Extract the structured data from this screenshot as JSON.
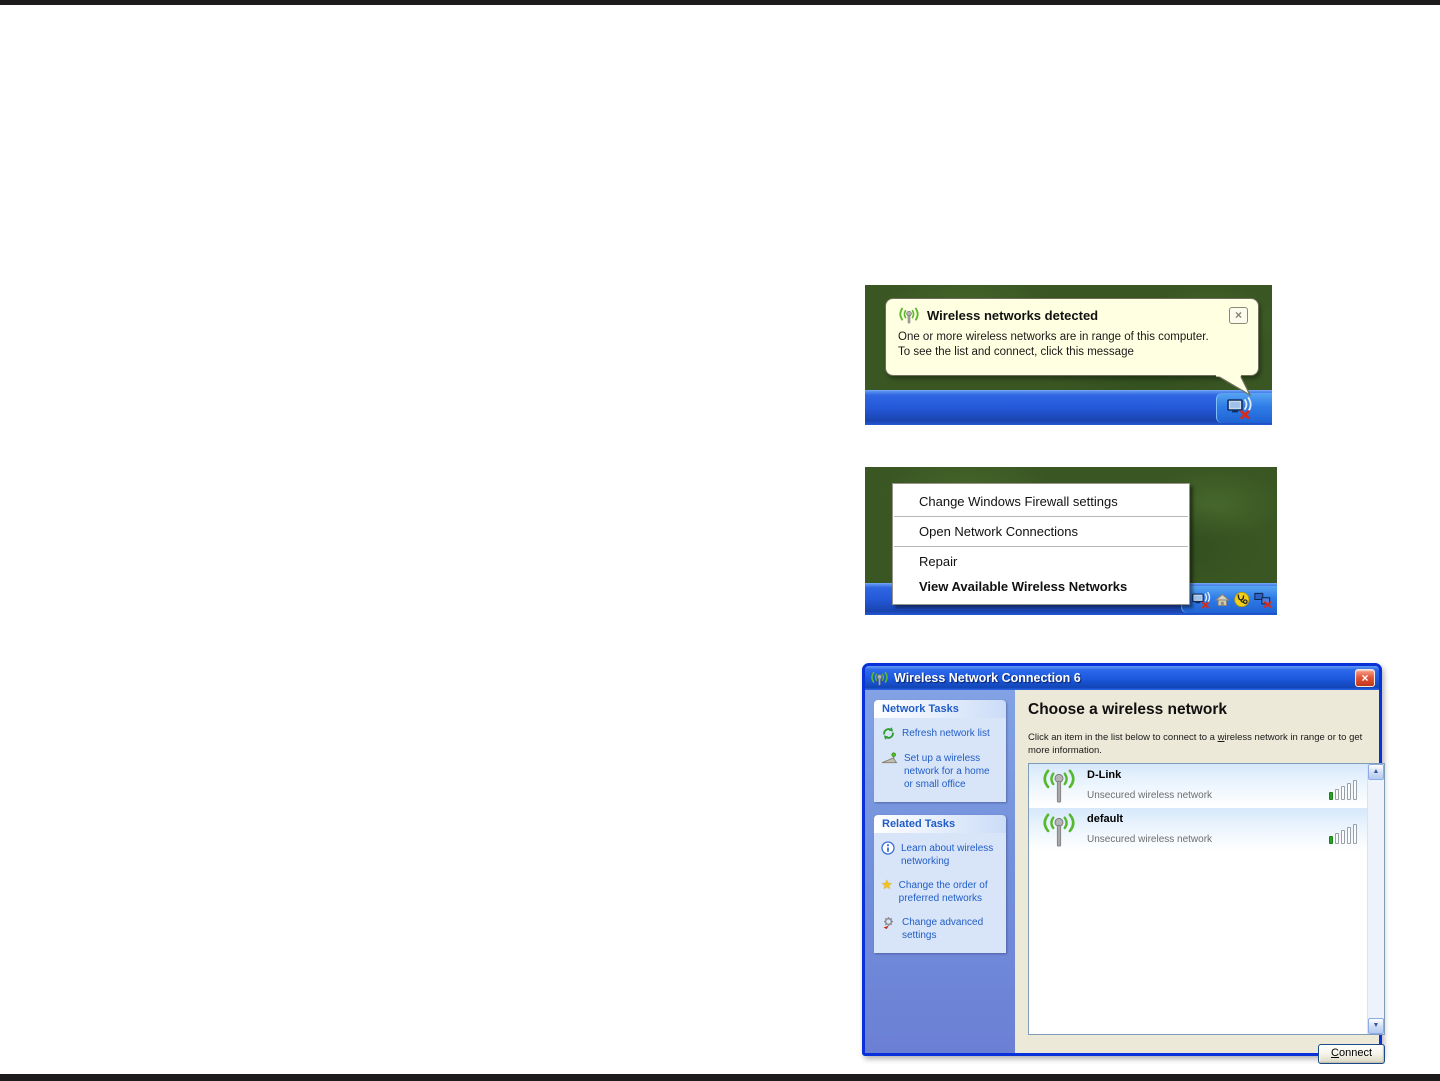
{
  "balloon_shot": {
    "title": "Wireless networks detected",
    "line1": "One or more wireless networks are in range of this computer.",
    "line2": "To see the list and connect, click this message"
  },
  "menu_shot": {
    "items": [
      {
        "label": "Change Windows Firewall settings"
      },
      {
        "label": "Open Network Connections"
      },
      {
        "label": "Repair"
      },
      {
        "label": "View Available Wireless Networks"
      }
    ]
  },
  "wnc": {
    "title": "Wireless Network Connection 6",
    "sidebar": {
      "panels": [
        {
          "header": "Network Tasks",
          "items": [
            {
              "label": "Refresh network list",
              "icon": "refresh-icon"
            },
            {
              "label": "Set up a wireless network for a home or small office",
              "icon": "wireless-setup-icon"
            }
          ]
        },
        {
          "header": "Related Tasks",
          "items": [
            {
              "label": "Learn about wireless networking",
              "icon": "info-icon"
            },
            {
              "label": "Change the order of preferred networks",
              "icon": "star-icon"
            },
            {
              "label": "Change advanced settings",
              "icon": "gear-icon"
            }
          ]
        }
      ]
    },
    "main": {
      "heading": "Choose a wireless network",
      "desc_pre": "Click an item in the list below to connect to a ",
      "desc_accel": "w",
      "desc_post": "ireless network in range or to get more information.",
      "networks": [
        {
          "name": "D-Link",
          "security": "Unsecured wireless network",
          "signal_bars": 5,
          "signal_on": 1
        },
        {
          "name": "default",
          "security": "Unsecured wireless network",
          "signal_bars": 5,
          "signal_on": 1
        }
      ],
      "connect_accel": "C",
      "connect_rest": "onnect"
    }
  },
  "icons": {
    "balloon_close": "×",
    "window_close": "×",
    "star": "★",
    "scroll_up": "▲",
    "scroll_down": "▼"
  },
  "colors": {
    "desktop-green": "#3a5723",
    "link": "#215dc6",
    "beige": "#ece9d8",
    "balloon-bg": "#ffffe1",
    "win-border": "#0831d9"
  }
}
